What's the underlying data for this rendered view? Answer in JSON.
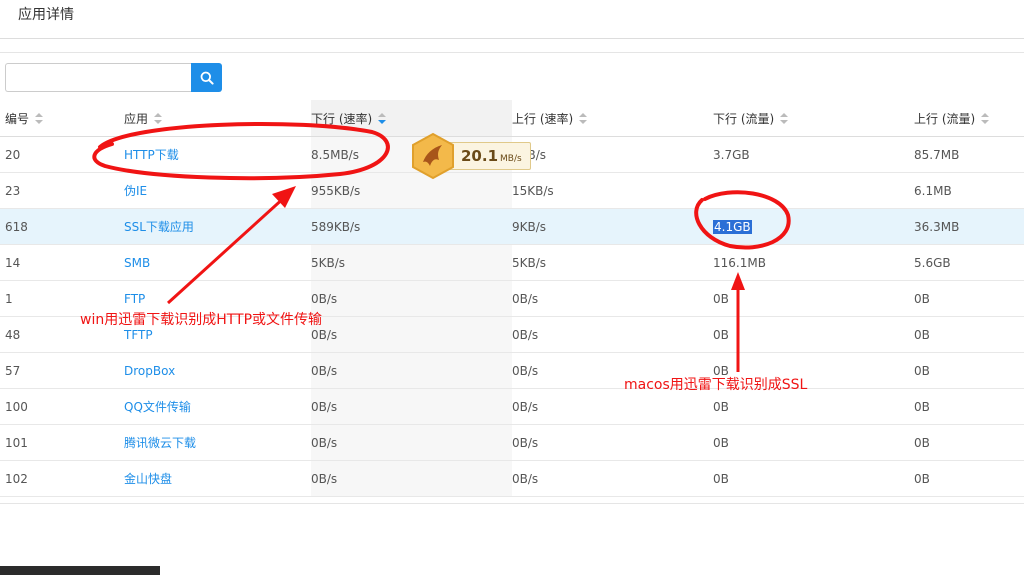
{
  "header": {
    "title": "应用详情"
  },
  "search": {
    "placeholder": "",
    "icon": "search-icon"
  },
  "table": {
    "columns": [
      {
        "label": "编号",
        "sort": "none"
      },
      {
        "label": "应用",
        "sort": "none"
      },
      {
        "label": "下行 (速率)",
        "sort": "desc"
      },
      {
        "label": "上行 (速率)",
        "sort": "none"
      },
      {
        "label": "下行 (流量)",
        "sort": "none"
      },
      {
        "label": "上行 (流量)",
        "sort": "none"
      }
    ],
    "rows": [
      {
        "id": "20",
        "app": "HTTP下载",
        "down_rate": "8.5MB/s",
        "up_rate": "2KB/s",
        "down_traffic": "3.7GB",
        "up_traffic": "85.7MB"
      },
      {
        "id": "23",
        "app": "伪IE",
        "down_rate": "955KB/s",
        "up_rate": "15KB/s",
        "down_traffic": "",
        "up_traffic": "6.1MB"
      },
      {
        "id": "618",
        "app": "SSL下载应用",
        "down_rate": "589KB/s",
        "up_rate": "9KB/s",
        "down_traffic": "4.1GB",
        "up_traffic": "36.3MB"
      },
      {
        "id": "14",
        "app": "SMB",
        "down_rate": "5KB/s",
        "up_rate": "5KB/s",
        "down_traffic": "116.1MB",
        "up_traffic": "5.6GB"
      },
      {
        "id": "1",
        "app": "FTP",
        "down_rate": "0B/s",
        "up_rate": "0B/s",
        "down_traffic": "0B",
        "up_traffic": "0B"
      },
      {
        "id": "48",
        "app": "TFTP",
        "down_rate": "0B/s",
        "up_rate": "0B/s",
        "down_traffic": "0B",
        "up_traffic": "0B"
      },
      {
        "id": "57",
        "app": "DropBox",
        "down_rate": "0B/s",
        "up_rate": "0B/s",
        "down_traffic": "0B",
        "up_traffic": "0B"
      },
      {
        "id": "100",
        "app": "QQ文件传输",
        "down_rate": "0B/s",
        "up_rate": "0B/s",
        "down_traffic": "0B",
        "up_traffic": "0B"
      },
      {
        "id": "101",
        "app": "腾讯微云下载",
        "down_rate": "0B/s",
        "up_rate": "0B/s",
        "down_traffic": "0B",
        "up_traffic": "0B"
      },
      {
        "id": "102",
        "app": "金山快盘",
        "down_rate": "0B/s",
        "up_rate": "0B/s",
        "down_traffic": "0B",
        "up_traffic": "0B"
      }
    ]
  },
  "widget": {
    "speed": "20.1",
    "unit": "MB/s",
    "icon": "thunder-bird-icon"
  },
  "annotations": {
    "win_note": "win用迅雷下载识别成HTTP或文件传输",
    "mac_note": "macos用迅雷下载识别成SSL"
  },
  "colors": {
    "link": "#1e8ee8",
    "annotation": "#f01414",
    "selected_row": "#e6f4fc"
  }
}
